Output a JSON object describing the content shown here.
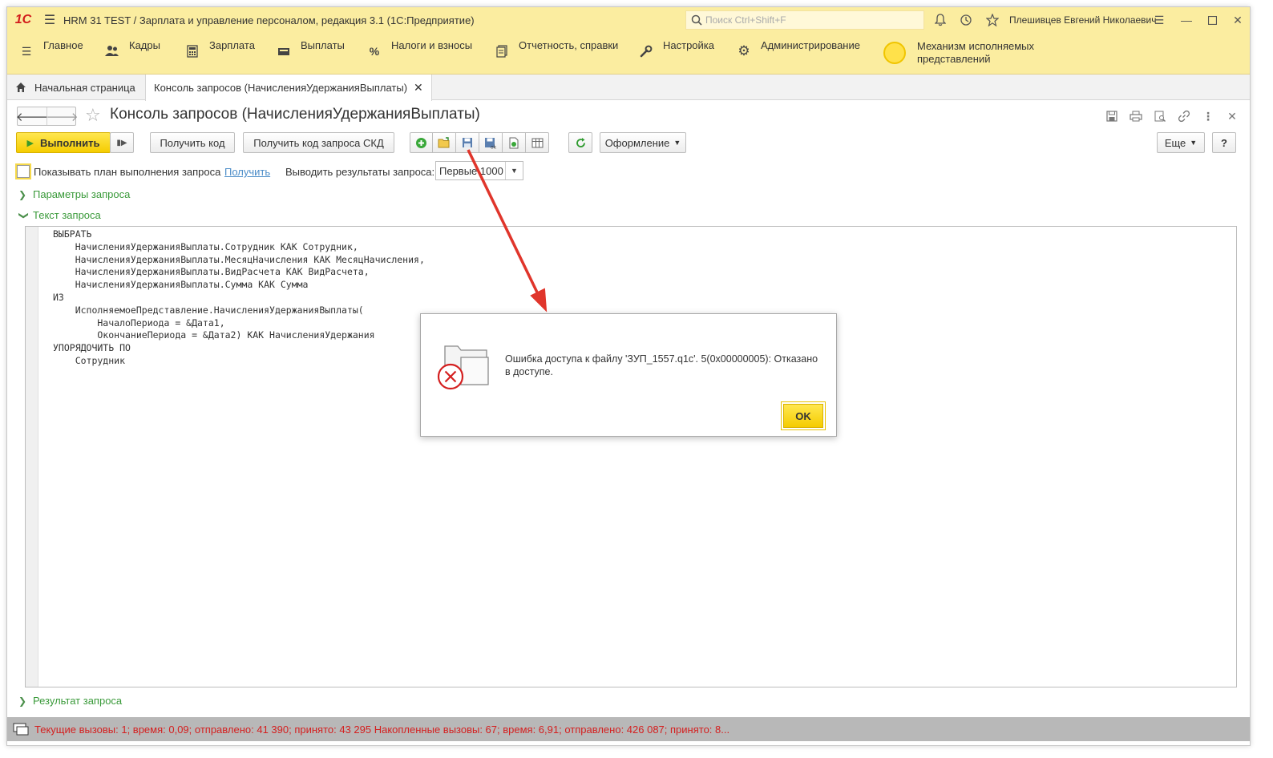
{
  "window": {
    "title": "HRM 31 TEST / Зарплата и управление персоналом, редакция 3.1  (1С:Предприятие)",
    "logo": "1С",
    "search_placeholder": "Поиск Ctrl+Shift+F",
    "user": "Плешивцев Евгений Николаевич"
  },
  "sections": [
    {
      "label": "Главное",
      "icon": "burger-icon"
    },
    {
      "label": "Кадры",
      "icon": "people-icon"
    },
    {
      "label": "Зарплата",
      "icon": "calculator-icon"
    },
    {
      "label": "Выплаты",
      "icon": "wallet-icon"
    },
    {
      "label": "Налоги и взносы",
      "icon": "percent-icon"
    },
    {
      "label": "Отчетность, справки",
      "icon": "reports-icon"
    },
    {
      "label": "Настройка",
      "icon": "wrench-icon"
    },
    {
      "label": "Администрирование",
      "icon": "gear-icon"
    },
    {
      "label1": "Механизм исполняемых",
      "label2": "представлений",
      "icon": "sun-icon"
    }
  ],
  "tabs": [
    {
      "label": "Начальная страница"
    },
    {
      "label": "Консоль запросов (НачисленияУдержанияВыплаты)"
    }
  ],
  "form": {
    "title": "Консоль запросов (НачисленияУдержанияВыплаты)"
  },
  "toolbar": {
    "execute": "Выполнить",
    "get_code": "Получить код",
    "get_skd_code": "Получить код запроса СКД",
    "design": "Оформление",
    "more": "Еще",
    "help": "?"
  },
  "options": {
    "show_plan": "Показывать план выполнения запроса",
    "get_link": "Получить",
    "output_label": "Выводить результаты запроса:",
    "output_value": "Первые 1000"
  },
  "groups": {
    "params": "Параметры запроса",
    "text": "Текст запроса",
    "result": "Результат запроса"
  },
  "query_text": "ВЫБРАТЬ\n    НачисленияУдержанияВыплаты.Сотрудник КАК Сотрудник,\n    НачисленияУдержанияВыплаты.МесяцНачисления КАК МесяцНачисления,\n    НачисленияУдержанияВыплаты.ВидРасчета КАК ВидРасчета,\n    НачисленияУдержанияВыплаты.Сумма КАК Сумма\nИЗ\n    ИсполняемоеПредставление.НачисленияУдержанияВыплаты(\n        НачалоПериода = &Дата1,\n        ОкончаниеПериода = &Дата2) КАК НачисленияУдержания\nУПОРЯДОЧИТЬ ПО\n    Сотрудник",
  "dialog": {
    "message": "Ошибка доступа к файлу 'ЗУП_1557.q1c'. 5(0x00000005): Отказано в доступе.",
    "ok": "OK"
  },
  "status": {
    "text": "Текущие вызовы: 1; время: 0,09; отправлено: 41 390; принято: 43 295    Накопленные вызовы: 67; время: 6,91; отправлено: 426 087; принято: 8..."
  },
  "colors": {
    "header_bg": "#fbeda0",
    "accent_yellow": "#f5cc00",
    "group_green": "#3a9a3a",
    "status_red": "#d42020",
    "arrow_red": "#e0352b"
  }
}
